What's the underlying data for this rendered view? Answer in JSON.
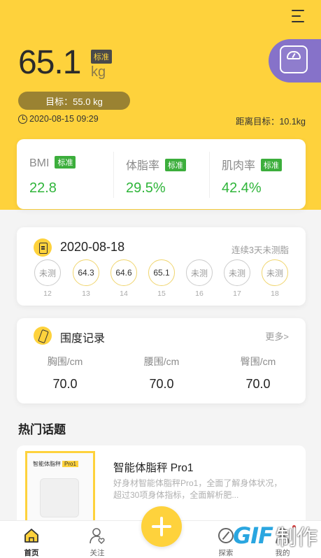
{
  "weight": {
    "value": "65.1",
    "status_badge": "标准",
    "unit": "kg",
    "goal_label": "目标：55.0 kg",
    "measured_at": "2020-08-15 09:29",
    "distance_to_goal": "距离目标：10.1kg"
  },
  "metrics": [
    {
      "label": "BMI",
      "badge": "标准",
      "value": "22.8"
    },
    {
      "label": "体脂率",
      "badge": "标准",
      "value": "29.5%"
    },
    {
      "label": "肌肉率",
      "badge": "标准",
      "value": "42.4%"
    }
  ],
  "calendar": {
    "date": "2020-08-18",
    "note": "连续3天未测脂",
    "days": [
      {
        "num": "12",
        "value": "未测",
        "state": "unmeasured"
      },
      {
        "num": "13",
        "value": "64.3",
        "state": "measured"
      },
      {
        "num": "14",
        "value": "64.6",
        "state": "measured"
      },
      {
        "num": "15",
        "value": "65.1",
        "state": "measured"
      },
      {
        "num": "16",
        "value": "未测",
        "state": "unmeasured"
      },
      {
        "num": "17",
        "value": "未测",
        "state": "unmeasured"
      },
      {
        "num": "18",
        "value": "未测",
        "state": "today"
      }
    ]
  },
  "girth": {
    "title": "围度记录",
    "more": "更多>",
    "items": [
      {
        "label": "胸围/cm",
        "value": "70.0"
      },
      {
        "label": "腰围/cm",
        "value": "70.0"
      },
      {
        "label": "臀围/cm",
        "value": "70.0"
      }
    ]
  },
  "topics": {
    "section_title": "热门话题",
    "items": [
      {
        "thumb_title": "智能体脂秤",
        "thumb_badge": "Pro1",
        "title": "智能体脂秤 Pro1",
        "desc": "好身材智能体脂秤Pro1，全面了解身体状况，超过30项身体指标，全面解析肥..."
      }
    ]
  },
  "tabbar": {
    "items": [
      {
        "label": "首页",
        "icon": "home-icon",
        "active": true
      },
      {
        "label": "关注",
        "icon": "user-heart-icon",
        "active": false
      },
      {
        "label": "探索",
        "icon": "compass-icon",
        "active": false
      },
      {
        "label": "我的",
        "icon": "profile-icon",
        "active": false
      }
    ]
  },
  "watermark": {
    "logo": "GIF",
    "text": "制作"
  },
  "colors": {
    "brand": "#fed23c",
    "good": "#2fb53a",
    "scale_button": "#8672c9"
  }
}
